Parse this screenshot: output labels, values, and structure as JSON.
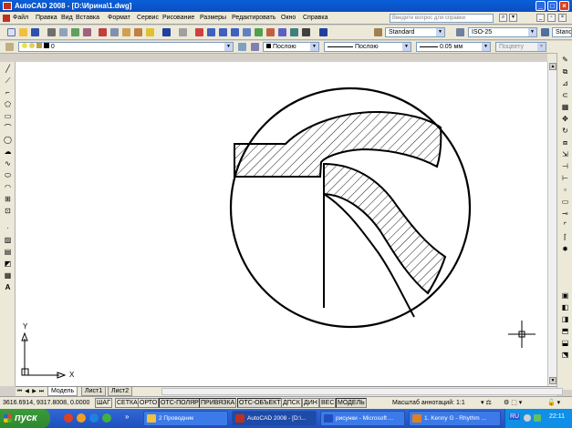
{
  "window": {
    "title": "AutoCAD 2008 - [D:\\Ирина\\1.dwg]"
  },
  "menu": [
    "Файл",
    "Правка",
    "Вид",
    "Вставка",
    "Формат",
    "Сервис",
    "Рисование",
    "Размеры",
    "Редактировать",
    "Окно",
    "Справка"
  ],
  "help": {
    "placeholder": "Введите вопрос для справки"
  },
  "styles": {
    "text_style": "Standard",
    "dim_style": "ISO-25",
    "table_style": "Standard"
  },
  "layers": {
    "current": "0"
  },
  "properties": {
    "color": "Послою",
    "linetype": "Послою",
    "lineweight": "0.05 мм",
    "plotstyle": "Поцвету"
  },
  "ucs": {
    "x_label": "X",
    "y_label": "Y"
  },
  "tabs": {
    "model": "Модель",
    "layout1": "Лист1",
    "layout2": "Лист2"
  },
  "status": {
    "coords": "3616.6914, 9317.8008, 0.0000",
    "buttons": [
      "ШАГ",
      "СЕТКА",
      "ОРТО",
      "ОТС-ПОЛЯР",
      "ПРИВЯЗКА",
      "ОТС-ОБЪЕКТ",
      "ДПСК",
      "ДИН",
      "ВЕС",
      "МОДЕЛЬ"
    ],
    "annotation_scale": "Масштаб аннотаций: 1:1"
  },
  "taskbar": {
    "start": "пуск",
    "tasks": [
      "2 Проводник",
      "AutoCAD 2008 - [D:\\...",
      "рисунки - Microsoft ...",
      "1. Kenny G - Rhythm ..."
    ],
    "lang": "RU",
    "clock": "22:11"
  },
  "colors": {
    "title_bg": "#0b56d0",
    "taskbar_bg": "#2a5fd0",
    "start_bg": "#3a9a3a"
  }
}
